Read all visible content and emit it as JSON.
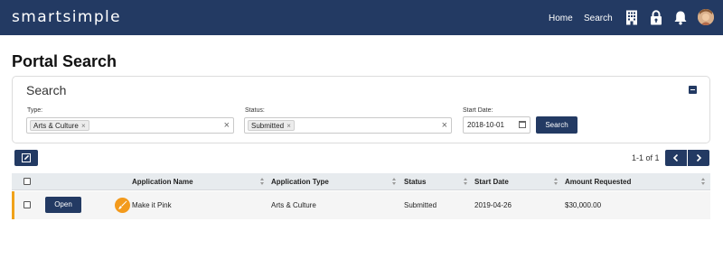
{
  "header": {
    "logo": "smartsimple",
    "nav": {
      "home": "Home",
      "search": "Search"
    },
    "icons": [
      "building-icon",
      "lock-icon",
      "bell-icon"
    ],
    "brand_color": "#233a63"
  },
  "page": {
    "title": "Portal Search"
  },
  "search_panel": {
    "title": "Search",
    "type_label": "Type:",
    "type_tag": "Arts & Culture",
    "status_label": "Status:",
    "status_tag": "Submitted",
    "start_date_label": "Start Date:",
    "start_date_value": "2018-10-01",
    "search_button": "Search",
    "tag_remove": "×",
    "clear": "×"
  },
  "results": {
    "pager_text": "1-1 of 1",
    "columns": [
      "Application Name",
      "Application Type",
      "Status",
      "Start Date",
      "Amount Requested"
    ],
    "rows": [
      {
        "action": "Open",
        "name": "Make it Pink",
        "type": "Arts & Culture",
        "status": "Submitted",
        "start_date": "2019-04-26",
        "amount": "$30,000.00",
        "accent_color": "#f0a21a"
      }
    ]
  }
}
